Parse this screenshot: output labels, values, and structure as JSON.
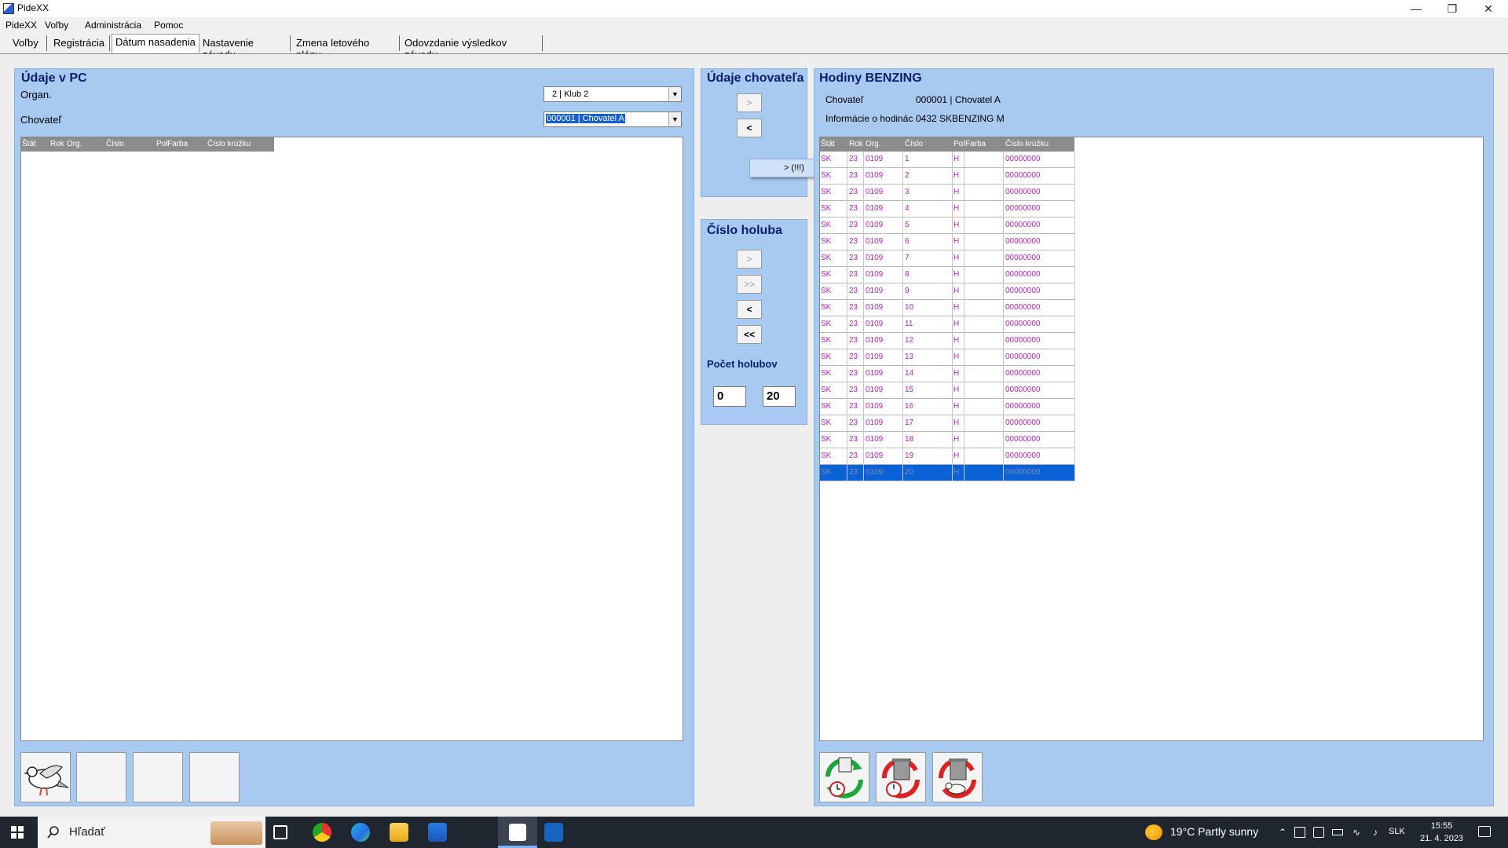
{
  "window": {
    "title": "PideXX"
  },
  "menu": [
    "PideXX",
    "Voľby",
    "Administrácia",
    "Pomoc"
  ],
  "tabs": [
    "Voľby",
    "Registrácia",
    "Dátum nasadenia",
    "Nastavenie závodu",
    "Zmena letového plánu",
    "Odovzdanie výsledkov závodu"
  ],
  "left_panel": {
    "title": "Údaje v PC",
    "organ_label": "Organ.",
    "organ_value": "2 | Klub 2",
    "chovatel_label": "Chovateľ",
    "chovatel_value": "000001 | Chovatel A",
    "columns": [
      "Štát",
      "Rok",
      "Org.",
      "Číslo",
      "Pol",
      "Farba",
      "Číslo krúžku"
    ]
  },
  "middle_top": {
    "title": "Údaje chovateľa",
    "btn_right": ">",
    "btn_left": "<",
    "popup": "> (!!!)"
  },
  "middle_bottom": {
    "title": "Číslo holuba",
    "btn_right": ">",
    "btn_all_right": ">>",
    "btn_left": "<",
    "btn_all_left": "<<",
    "count_label": "Počet holubov",
    "count_left": "0",
    "count_right": "20"
  },
  "right_panel": {
    "title": "Hodiny BENZING",
    "chovatel_label": "Chovateľ",
    "chovatel_value": "000001 | Chovatel A",
    "info_label": "Informácie o hodinác",
    "info_value": "0432 SKBENZING M",
    "columns": [
      "Štát",
      "Rok",
      "Org.",
      "Číslo",
      "Pol",
      "Farba",
      "Číslo krúžku"
    ],
    "rows": [
      {
        "stat": "SK",
        "rok": "23",
        "org": "0109",
        "cislo": "1",
        "pol": "H",
        "farba": "",
        "kruzok": "00000000"
      },
      {
        "stat": "SK",
        "rok": "23",
        "org": "0109",
        "cislo": "2",
        "pol": "H",
        "farba": "",
        "kruzok": "00000000"
      },
      {
        "stat": "SK",
        "rok": "23",
        "org": "0109",
        "cislo": "3",
        "pol": "H",
        "farba": "",
        "kruzok": "00000000"
      },
      {
        "stat": "SK",
        "rok": "23",
        "org": "0109",
        "cislo": "4",
        "pol": "H",
        "farba": "",
        "kruzok": "00000000"
      },
      {
        "stat": "SK",
        "rok": "23",
        "org": "0109",
        "cislo": "5",
        "pol": "H",
        "farba": "",
        "kruzok": "00000000"
      },
      {
        "stat": "SK",
        "rok": "23",
        "org": "0109",
        "cislo": "6",
        "pol": "H",
        "farba": "",
        "kruzok": "00000000"
      },
      {
        "stat": "SK",
        "rok": "23",
        "org": "0109",
        "cislo": "7",
        "pol": "H",
        "farba": "",
        "kruzok": "00000000"
      },
      {
        "stat": "SK",
        "rok": "23",
        "org": "0109",
        "cislo": "8",
        "pol": "H",
        "farba": "",
        "kruzok": "00000000"
      },
      {
        "stat": "SK",
        "rok": "23",
        "org": "0109",
        "cislo": "9",
        "pol": "H",
        "farba": "",
        "kruzok": "00000000"
      },
      {
        "stat": "SK",
        "rok": "23",
        "org": "0109",
        "cislo": "10",
        "pol": "H",
        "farba": "",
        "kruzok": "00000000"
      },
      {
        "stat": "SK",
        "rok": "23",
        "org": "0109",
        "cislo": "11",
        "pol": "H",
        "farba": "",
        "kruzok": "00000000"
      },
      {
        "stat": "SK",
        "rok": "23",
        "org": "0109",
        "cislo": "12",
        "pol": "H",
        "farba": "",
        "kruzok": "00000000"
      },
      {
        "stat": "SK",
        "rok": "23",
        "org": "0109",
        "cislo": "13",
        "pol": "H",
        "farba": "",
        "kruzok": "00000000"
      },
      {
        "stat": "SK",
        "rok": "23",
        "org": "0109",
        "cislo": "14",
        "pol": "H",
        "farba": "",
        "kruzok": "00000000"
      },
      {
        "stat": "SK",
        "rok": "23",
        "org": "0109",
        "cislo": "15",
        "pol": "H",
        "farba": "",
        "kruzok": "00000000"
      },
      {
        "stat": "SK",
        "rok": "23",
        "org": "0109",
        "cislo": "16",
        "pol": "H",
        "farba": "",
        "kruzok": "00000000"
      },
      {
        "stat": "SK",
        "rok": "23",
        "org": "0109",
        "cislo": "17",
        "pol": "H",
        "farba": "",
        "kruzok": "00000000"
      },
      {
        "stat": "SK",
        "rok": "23",
        "org": "0109",
        "cislo": "18",
        "pol": "H",
        "farba": "",
        "kruzok": "00000000"
      },
      {
        "stat": "SK",
        "rok": "23",
        "org": "0109",
        "cislo": "19",
        "pol": "H",
        "farba": "",
        "kruzok": "00000000"
      },
      {
        "stat": "SK",
        "rok": "23",
        "org": "0109",
        "cislo": "20",
        "pol": "H",
        "farba": "",
        "kruzok": "00000000",
        "selected": true
      }
    ]
  },
  "taskbar": {
    "search_placeholder": "Hľadať",
    "weather": "19°C Partly sunny",
    "lang": "SLK",
    "time": "15:55",
    "date": "21. 4. 2023"
  },
  "colors": {
    "panel_bg": "#a8c9f0",
    "panel_title": "#0a1f6e",
    "row_text": "#c020c0",
    "row_selected": "#0a62d6",
    "grid_header": "#8c8c8c"
  }
}
